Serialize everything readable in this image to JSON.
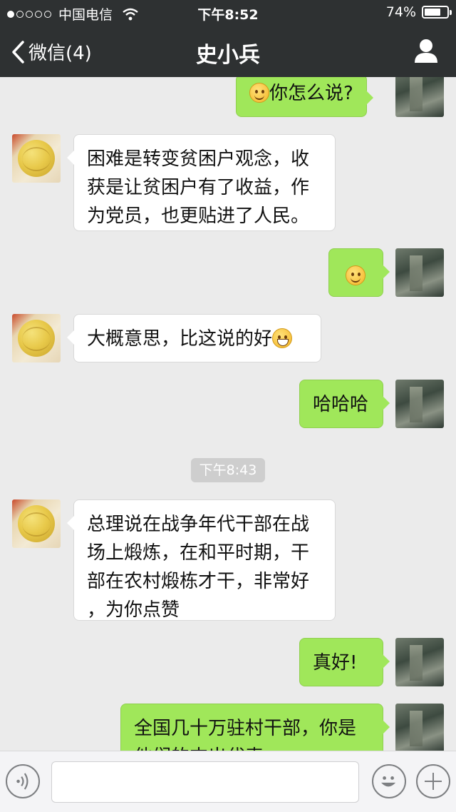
{
  "status_bar": {
    "carrier": "中国电信",
    "time": "下午8:52",
    "battery": "74%",
    "battery_level": 0.74,
    "signal_bars": 1,
    "icons": [
      "signal-dots-icon",
      "wifi-icon",
      "battery-icon"
    ]
  },
  "nav": {
    "back_label": "微信(4)",
    "title": "史小兵",
    "icons": [
      "chevron-left-icon",
      "profile-icon"
    ]
  },
  "messages": [
    {
      "side": "right",
      "text": "你怎么说?",
      "emoji": "smile"
    },
    {
      "side": "left",
      "lines": [
        "困难是转变贫困户观念，收",
        "获是让贫困户有了收益，作",
        "为党员，也更贴进了人民。"
      ]
    },
    {
      "side": "right",
      "emoji": "smile"
    },
    {
      "side": "left",
      "text": "大概意思，比这说的好",
      "emoji": "grin"
    },
    {
      "side": "right",
      "text": "哈哈哈"
    },
    {
      "timestamp": "下午8:43"
    },
    {
      "side": "left",
      "lines": [
        "总理说在战争年代干部在战",
        "场上煅炼，在和平时期，干",
        "部在农村煅栋才干，非常好",
        "，为你点赞"
      ]
    },
    {
      "side": "right",
      "text": "真好!"
    },
    {
      "side": "right",
      "lines": [
        "全国几十万驻村干部，你是",
        "他们的杰出代表"
      ]
    }
  ],
  "input_bar": {
    "icons": [
      "voice-icon",
      "emoji-icon",
      "plus-icon"
    ]
  },
  "colors": {
    "bar_bg": "#2e3132",
    "chat_bg": "#ebebeb",
    "right_bubble": "#a0e75a",
    "left_bubble": "#ffffff"
  }
}
